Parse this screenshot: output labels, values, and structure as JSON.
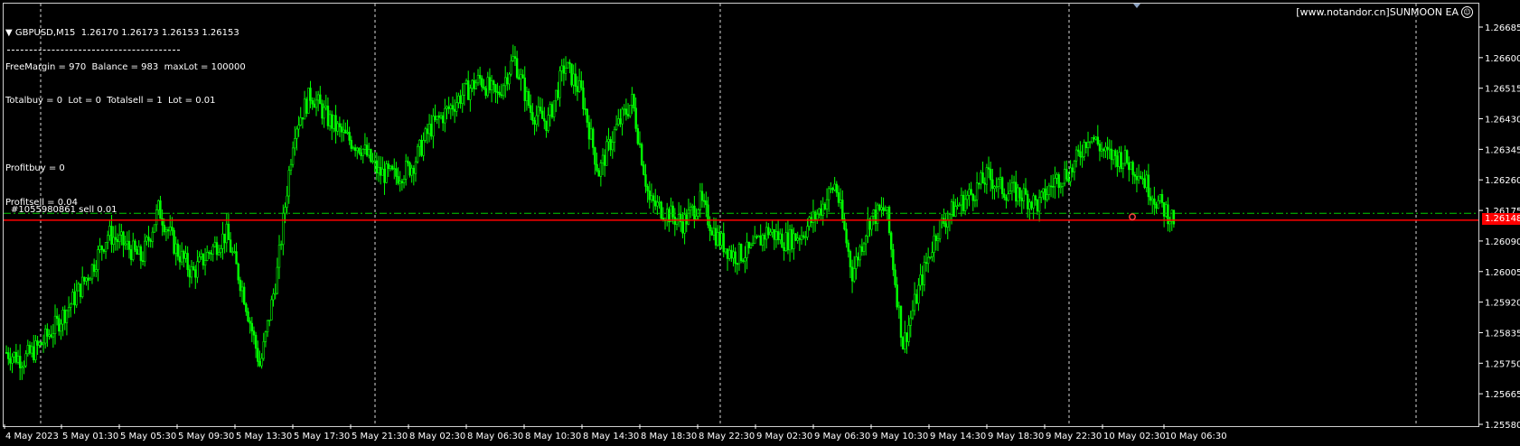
{
  "header": {
    "symbol_line": "GBPUSD,M15  1.26170 1.26173 1.26153 1.26153",
    "free_margin_line": "FreeMargin = 970  Balance = 983  maxLot = 100000",
    "totals_line": "Totalbuy = 0  Lot = 0  Totalsell = 1  Lot = 0.01",
    "profit_buy_line": "Profitbuy = 0",
    "profit_sell_line": "Profitsell = 0.04"
  },
  "brand": {
    "text": "[www.notandor.cn]SUNMOON EA",
    "icon": "smiley-icon"
  },
  "trade": {
    "label": "#1055980861 sell 0.01",
    "current_price_tag": "1.26148"
  },
  "colors": {
    "background": "#000000",
    "candles": "#00ff00",
    "bid_line": "#ff0000",
    "order_line": "#00cc00",
    "grid": "#ffffff"
  },
  "chart_data": {
    "type": "candlestick",
    "symbol": "GBPUSD",
    "timeframe": "M15",
    "y_ticks": [
      "1.26685",
      "1.26600",
      "1.26515",
      "1.26430",
      "1.26345",
      "1.26260",
      "1.26175",
      "1.26090",
      "1.26005",
      "1.25920",
      "1.25835",
      "1.25750",
      "1.25665",
      "1.25580"
    ],
    "ylim": [
      1.2555,
      1.2672
    ],
    "x_ticks": [
      "4 May 2023",
      "5 May 01:30",
      "5 May 05:30",
      "5 May 09:30",
      "5 May 13:30",
      "5 May 17:30",
      "5 May 21:30",
      "8 May 02:30",
      "8 May 06:30",
      "8 May 10:30",
      "8 May 14:30",
      "8 May 18:30",
      "8 May 22:30",
      "9 May 02:30",
      "9 May 06:30",
      "9 May 10:30",
      "9 May 14:30",
      "9 May 18:30",
      "9 May 22:30",
      "10 May 02:30",
      "10 May 06:30"
    ],
    "close_series": [
      1.2578,
      1.2576,
      1.258,
      1.2586,
      1.2593,
      1.2601,
      1.2611,
      1.2608,
      1.2604,
      1.2618,
      1.2607,
      1.26,
      1.2606,
      1.2611,
      1.2595,
      1.2574,
      1.26,
      1.264,
      1.265,
      1.2643,
      1.2638,
      1.2635,
      1.2628,
      1.2627,
      1.263,
      1.264,
      1.2645,
      1.265,
      1.2654,
      1.2649,
      1.266,
      1.2645,
      1.2642,
      1.2658,
      1.265,
      1.2628,
      1.264,
      1.2648,
      1.262,
      1.2617,
      1.2614,
      1.262,
      1.261,
      1.2605,
      1.2606,
      1.2612,
      1.2609,
      1.2611,
      1.2617,
      1.2625,
      1.26,
      1.2615,
      1.2618,
      1.258,
      1.2597,
      1.2612,
      1.2618,
      1.2622,
      1.2627,
      1.2623,
      1.2622,
      1.2619,
      1.2626,
      1.2629,
      1.2639,
      1.2633,
      1.2632,
      1.2628,
      1.262,
      1.2615
    ],
    "open_order": {
      "type": "sell",
      "lots": 0.01,
      "ticket": "1055980861",
      "price": 1.26167
    },
    "bid": 1.26148
  }
}
